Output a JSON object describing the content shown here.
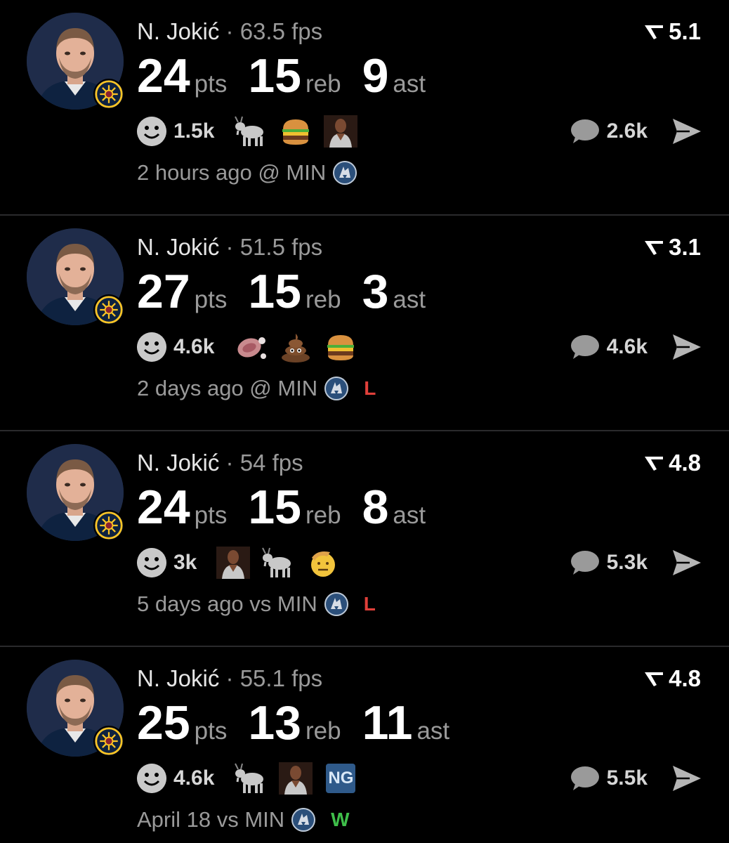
{
  "colors": {
    "background": "#000000",
    "loss": "#e0403a",
    "win": "#3fbf4a",
    "muted": "#9a9a9a"
  },
  "posts": [
    {
      "player": "N. Jokić",
      "separator": "·",
      "fps": "63.5 fps",
      "rating": "5.1",
      "pts": "24",
      "pts_label": "pts",
      "reb": "15",
      "reb_label": "reb",
      "ast": "9",
      "ast_label": "ast",
      "reactions_count": "1.5k",
      "reaction_icons": [
        "goat-emoji",
        "burger-emoji",
        "player-sticker"
      ],
      "comments_count": "2.6k",
      "time": "2 hours ago @ MIN",
      "result": ""
    },
    {
      "player": "N. Jokić",
      "separator": "·",
      "fps": "51.5 fps",
      "rating": "3.1",
      "pts": "27",
      "pts_label": "pts",
      "reb": "15",
      "reb_label": "reb",
      "ast": "3",
      "ast_label": "ast",
      "reactions_count": "4.6k",
      "reaction_icons": [
        "meat-emoji",
        "poop-emoji",
        "burger-emoji"
      ],
      "comments_count": "4.6k",
      "time": "2 days ago @ MIN",
      "result": "L"
    },
    {
      "player": "N. Jokić",
      "separator": "·",
      "fps": "54 fps",
      "rating": "4.8",
      "pts": "24",
      "pts_label": "pts",
      "reb": "15",
      "reb_label": "reb",
      "ast": "8",
      "ast_label": "ast",
      "reactions_count": "3k",
      "reaction_icons": [
        "player-sticker",
        "goat-emoji",
        "salute-emoji"
      ],
      "comments_count": "5.3k",
      "time": "5 days ago vs MIN",
      "result": "L"
    },
    {
      "player": "N. Jokić",
      "separator": "·",
      "fps": "55.1 fps",
      "rating": "4.8",
      "pts": "25",
      "pts_label": "pts",
      "reb": "13",
      "reb_label": "reb",
      "ast": "11",
      "ast_label": "ast",
      "reactions_count": "4.6k",
      "reaction_icons": [
        "goat-emoji",
        "player-sticker",
        "ng-badge"
      ],
      "ng_badge_text": "NG",
      "comments_count": "5.5k",
      "time": "April 18 vs MIN",
      "result": "W"
    }
  ]
}
